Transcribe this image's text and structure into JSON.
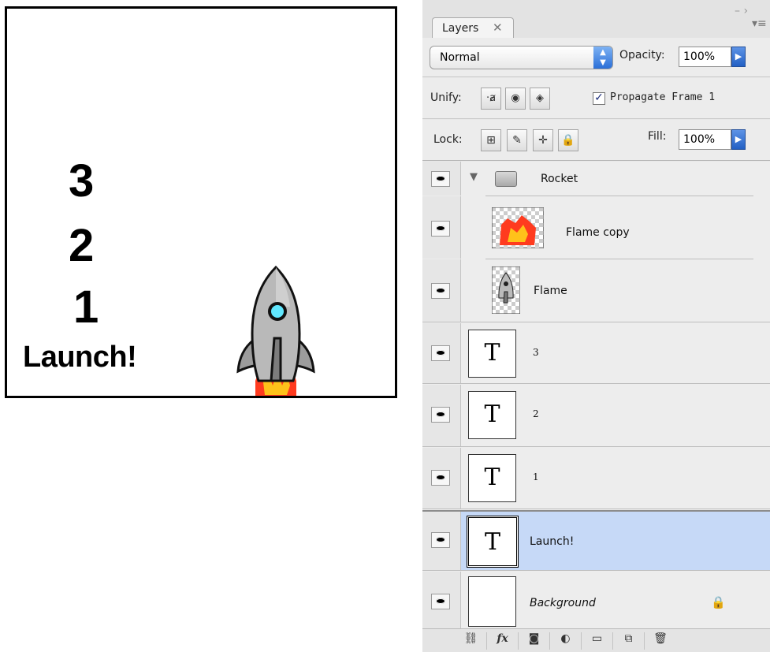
{
  "canvas": {
    "countdown": [
      "3",
      "2",
      "1"
    ],
    "launch_text": "Launch!"
  },
  "panel": {
    "tab_label": "Layers",
    "blend_mode": "Normal",
    "opacity_label": "Opacity:",
    "opacity_value": "100%",
    "unify_label": "Unify:",
    "propagate_label": "Propagate Frame 1",
    "propagate_checked": true,
    "lock_label": "Lock:",
    "fill_label": "Fill:",
    "fill_value": "100%",
    "layers": [
      {
        "name": "Rocket",
        "kind": "group",
        "visible": true
      },
      {
        "name": "Flame copy",
        "kind": "image",
        "visible": true
      },
      {
        "name": "Flame",
        "kind": "image",
        "visible": true
      },
      {
        "name": "3",
        "kind": "text",
        "visible": true
      },
      {
        "name": "2",
        "kind": "text",
        "visible": true
      },
      {
        "name": "1",
        "kind": "text",
        "visible": true
      },
      {
        "name": "Launch!",
        "kind": "text",
        "visible": true,
        "selected": true
      },
      {
        "name": "Background",
        "kind": "background",
        "visible": true,
        "locked": true
      }
    ],
    "bottom_buttons": [
      "link-layers-icon",
      "fx-icon",
      "layer-mask-icon",
      "adjustment-layer-icon",
      "new-group-icon",
      "new-layer-icon",
      "trash-icon"
    ],
    "fx_label": "fx"
  },
  "colors": {
    "selection": "#c6d9f7",
    "accent": "#2b6fd8"
  }
}
